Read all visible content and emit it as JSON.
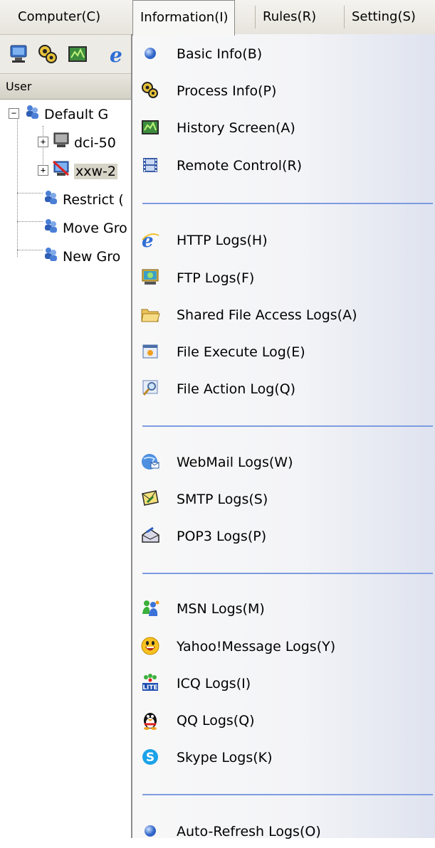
{
  "menubar": {
    "items": [
      {
        "label": "Computer(C)",
        "active": false
      },
      {
        "label": "Information(I)",
        "active": true
      },
      {
        "label": "Rules(R)",
        "active": false
      },
      {
        "label": "Setting(S)",
        "active": false
      }
    ]
  },
  "toolbar": {
    "icons": [
      "computer-icon",
      "gears-icon",
      "screen-history-icon",
      "internet-explorer-icon"
    ]
  },
  "left_pane": {
    "column_header": "User",
    "tree": [
      {
        "label": "Default G",
        "icon": "group-icon",
        "level": 0
      },
      {
        "label": "dci-50",
        "icon": "computer-icon",
        "level": 1
      },
      {
        "label": "xxw-2",
        "icon": "computer-offline-icon",
        "level": 1,
        "selected": true
      },
      {
        "label": "Restrict (",
        "icon": "group-icon",
        "level": 0
      },
      {
        "label": "Move Gro",
        "icon": "group-icon",
        "level": 0
      },
      {
        "label": "New Gro",
        "icon": "group-icon",
        "level": 0
      }
    ]
  },
  "dropdown": {
    "groups": [
      [
        {
          "label": "Basic Info(B)",
          "icon": "blue-sphere-icon"
        },
        {
          "label": "Process Info(P)",
          "icon": "gears-icon"
        },
        {
          "label": "History Screen(A)",
          "icon": "screen-history-icon"
        },
        {
          "label": "Remote Control(R)",
          "icon": "film-icon"
        }
      ],
      [
        {
          "label": "HTTP Logs(H)",
          "icon": "internet-explorer-icon"
        },
        {
          "label": "FTP Logs(F)",
          "icon": "ftp-icon"
        },
        {
          "label": "Shared File Access Logs(A)",
          "icon": "folder-icon"
        },
        {
          "label": "File Execute Log(E)",
          "icon": "file-execute-icon"
        },
        {
          "label": "File Action Log(Q)",
          "icon": "magnifier-icon"
        }
      ],
      [
        {
          "label": "WebMail Logs(W)",
          "icon": "webmail-icon"
        },
        {
          "label": "SMTP Logs(S)",
          "icon": "smtp-icon"
        },
        {
          "label": "POP3 Logs(P)",
          "icon": "pop3-icon"
        }
      ],
      [
        {
          "label": "MSN Logs(M)",
          "icon": "msn-icon"
        },
        {
          "label": "Yahoo!Message Logs(Y)",
          "icon": "yahoo-icon"
        },
        {
          "label": "ICQ Logs(I)",
          "icon": "icq-icon"
        },
        {
          "label": "QQ Logs(Q)",
          "icon": "qq-icon"
        },
        {
          "label": "Skype Logs(K)",
          "icon": "skype-icon"
        }
      ],
      [
        {
          "label": "Auto-Refresh Logs(O)",
          "icon": "blue-sphere-icon"
        }
      ]
    ]
  },
  "colors": {
    "separator": "#7d9ce0",
    "menu_border": "#8d8d8d",
    "selected_bg": "#d6d3c7"
  }
}
